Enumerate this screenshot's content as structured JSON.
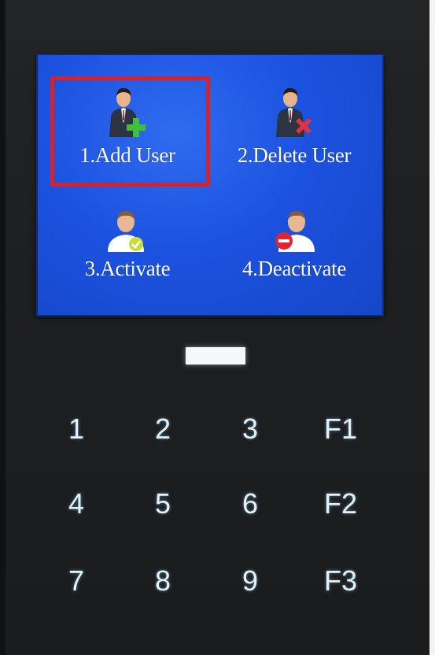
{
  "screen": {
    "items": [
      {
        "label": "1.Add User",
        "icon": "add-user-icon",
        "selected": true
      },
      {
        "label": "2.Delete User",
        "icon": "delete-user-icon",
        "selected": false
      },
      {
        "label": "3.Activate",
        "icon": "activate-user-icon",
        "selected": false
      },
      {
        "label": "4.Deactivate",
        "icon": "deactivate-user-icon",
        "selected": false
      }
    ],
    "background_color": "#1c52e0",
    "selection_color": "#d8222a"
  },
  "keypad": {
    "rows": [
      [
        "1",
        "2",
        "3",
        "F1"
      ],
      [
        "4",
        "5",
        "6",
        "F2"
      ],
      [
        "7",
        "8",
        "9",
        "F3"
      ]
    ]
  }
}
